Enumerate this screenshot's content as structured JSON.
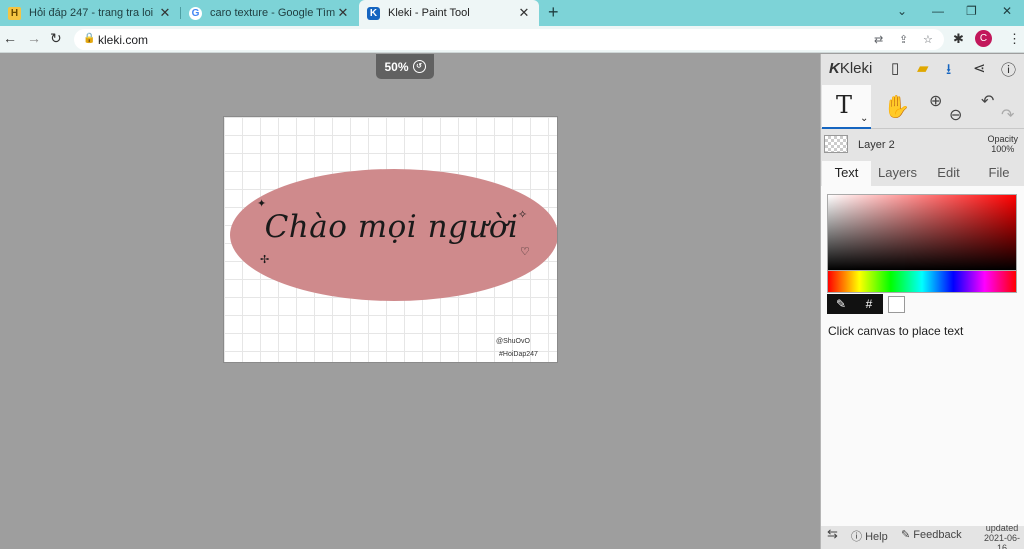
{
  "browser": {
    "tabs": [
      {
        "title": "Hỏi đáp 247 - trang tra loi",
        "icon": "hoidap-favicon",
        "active": false
      },
      {
        "title": "caro texture - Google Tìm kiếm",
        "icon": "google-favicon",
        "active": false
      },
      {
        "title": "Kleki - Paint Tool",
        "icon": "kleki-favicon",
        "active": true
      }
    ],
    "new_tab": "+",
    "url": "kleki.com",
    "profile_initial": "C",
    "colors": {
      "tabbar": "#7dd3d7",
      "toolbar": "#eef6f6"
    }
  },
  "canvas": {
    "zoom": "50%",
    "artwork_text": "Chào mọi người",
    "credit_user": "@ShuOvO",
    "credit_tag": "#HoiDap247",
    "colors": {
      "ellipse": "#cf8a8c",
      "background": "#9e9e9e"
    }
  },
  "panel": {
    "brand": "Kleki",
    "layer": {
      "name": "Layer 2",
      "opacity_label": "Opacity",
      "opacity_value": "100%"
    },
    "tabs": [
      "Text",
      "Layers",
      "Edit",
      "File"
    ],
    "active_tab": "Text",
    "hex_label": "#",
    "hint": "Click canvas to place text",
    "footer": {
      "help": "Help",
      "feedback": "Feedback",
      "updated_label": "updated",
      "updated_date": "2021-06-16"
    }
  }
}
